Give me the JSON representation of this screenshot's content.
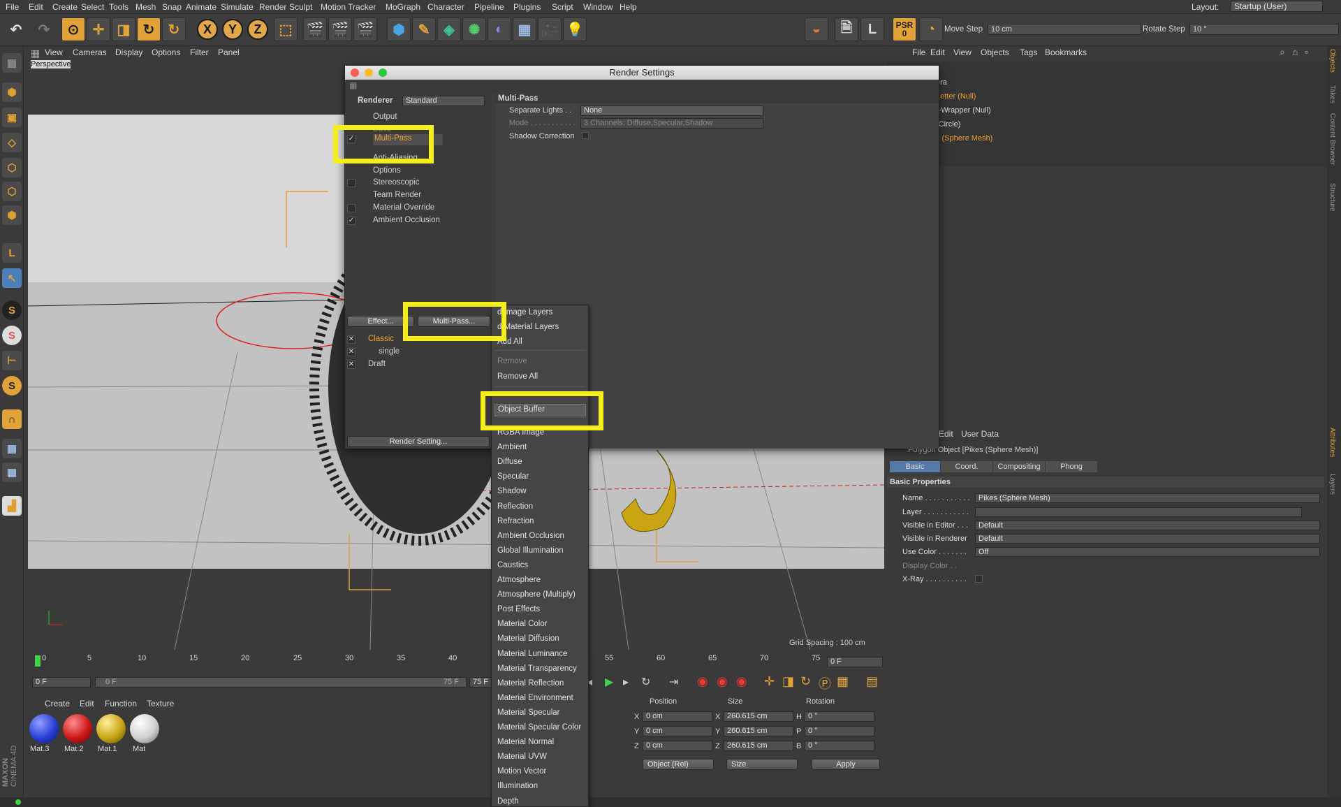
{
  "menubar": {
    "items": [
      "File",
      "Edit",
      "Create",
      "Select",
      "Tools",
      "Mesh",
      "Snap",
      "Animate",
      "Simulate",
      "Render",
      "Sculpt",
      "Motion Tracker",
      "MoGraph",
      "Character",
      "Pipeline",
      "Plugins",
      "Script",
      "Window",
      "Help"
    ],
    "layout_label": "Layout:",
    "layout_value": "Startup (User)"
  },
  "toolbar": {
    "x_label": "X",
    "y_label": "Y",
    "z_label": "Z",
    "psr_label": "PSR",
    "psr_value": "0",
    "move_step_label": "Move Step",
    "move_step_value": "10 cm",
    "rotate_step_label": "Rotate Step",
    "rotate_step_value": "10 °"
  },
  "viewport": {
    "menu": [
      "View",
      "Cameras",
      "Display",
      "Options",
      "Filter",
      "Panel"
    ],
    "name": "Perspective",
    "grid_spacing": "Grid Spacing : 100 cm"
  },
  "object_manager": {
    "menu": [
      "File",
      "Edit",
      "View",
      "Objects",
      "Tags",
      "Bookmarks"
    ],
    "rows": [
      "era",
      "Letter (Null)",
      "r-Wrapper (Null)",
      "(Circle)",
      "s (Sphere Mesh)"
    ]
  },
  "attribute_manager": {
    "menu": [
      "Edit",
      "User Data"
    ],
    "object_title": "Polygon Object [Pikes (Sphere Mesh)]",
    "tabs": [
      "Basic",
      "Coord.",
      "Compositing",
      "Phong"
    ],
    "section": "Basic Properties",
    "props": [
      {
        "label": "Name . . . . . . . . . . .",
        "value": "Pikes (Sphere Mesh)"
      },
      {
        "label": "Layer . . . . . . . . . . .",
        "value": ""
      },
      {
        "label": "Visible in Editor . . .",
        "value": "Default"
      },
      {
        "label": "Visible in Renderer",
        "value": "Default"
      },
      {
        "label": "Use Color . . . . . . .",
        "value": "Off"
      },
      {
        "label": "Display Color . .",
        "value": ""
      },
      {
        "label": "X-Ray . . . . . . . . . .",
        "value": ""
      }
    ]
  },
  "render_settings": {
    "title": "Render Settings",
    "renderer_label": "Renderer",
    "renderer_value": "Standard",
    "tree": [
      "Output",
      "Save",
      "Multi-Pass",
      "Anti-Aliasing",
      "Options",
      "Stereoscopic",
      "Team Render",
      "Material Override",
      "Ambient Occlusion"
    ],
    "effect_button": "Effect...",
    "multipass_button": "Multi-Pass...",
    "presets": [
      "Classic",
      "single",
      "Draft"
    ],
    "render_setting_button": "Render Setting...",
    "panel_title": "Multi-Pass",
    "separate_lights_label": "Separate Lights . .",
    "separate_lights_value": "None",
    "mode_label": "Mode . . . . . . . . . . .",
    "mode_value": "3 Channels: Diffuse,Specular,Shadow",
    "shadow_correction_label": "Shadow Correction"
  },
  "popup_menu": {
    "top_items": [
      "d Image Layers",
      "d Material Layers",
      "Add All"
    ],
    "remove_items": [
      "Remove",
      "Remove All"
    ],
    "highlighted": "Object Buffer",
    "channels": [
      "RGBA Image",
      "Ambient",
      "Diffuse",
      "Specular",
      "Shadow",
      "Reflection",
      "Refraction",
      "Ambient Occlusion",
      "Global Illumination",
      "Caustics",
      "Atmosphere",
      "Atmosphere (Multiply)",
      "Post Effects",
      "Material Color",
      "Material Diffusion",
      "Material Luminance",
      "Material Transparency",
      "Material Reflection",
      "Material Environment",
      "Material Specular",
      "Material Specular Color",
      "Material Normal",
      "Material UVW",
      "Motion Vector",
      "Illumination",
      "Depth"
    ]
  },
  "timeline": {
    "ticks": [
      "0",
      "5",
      "10",
      "15",
      "20",
      "25",
      "30",
      "35",
      "40",
      "55",
      "60",
      "65",
      "70",
      "75"
    ],
    "frame_value": "0 F",
    "start_field": "0 F",
    "range_start": "0 F",
    "range_end": "75 F",
    "end_field": "75 F"
  },
  "material_manager": {
    "menu": [
      "Create",
      "Edit",
      "Function",
      "Texture"
    ],
    "materials": [
      {
        "name": "Mat.3",
        "color": "#2a3fd6"
      },
      {
        "name": "Mat.2",
        "color": "#cc1818"
      },
      {
        "name": "Mat.1",
        "color": "#c9a514"
      },
      {
        "name": "Mat",
        "color": "#cfcfcf"
      }
    ]
  },
  "coordinates": {
    "headers": [
      "Position",
      "Size",
      "Rotation"
    ],
    "rows": [
      {
        "axis": "X",
        "pos": "0 cm",
        "size_axis": "X",
        "size": "260.615 cm",
        "rot_axis": "H",
        "rot": "0 °"
      },
      {
        "axis": "Y",
        "pos": "0 cm",
        "size_axis": "Y",
        "size": "260.615 cm",
        "rot_axis": "P",
        "rot": "0 °"
      },
      {
        "axis": "Z",
        "pos": "0 cm",
        "size_axis": "Z",
        "size": "260.615 cm",
        "rot_axis": "B",
        "rot": "0 °"
      }
    ],
    "mode_value": "Object (Rel)",
    "size_mode_value": "Size",
    "apply_label": "Apply"
  },
  "brand": {
    "maxon": "MAXON",
    "cinema": "CINEMA 4D"
  },
  "right_tabs": [
    "Objects",
    "Takes",
    "Content Browser",
    "Structure",
    "Attributes",
    "Layers"
  ],
  "colors": {
    "accent": "#e2a23a",
    "highlight": "#f4ef1a",
    "orange_text": "#f0a030"
  }
}
